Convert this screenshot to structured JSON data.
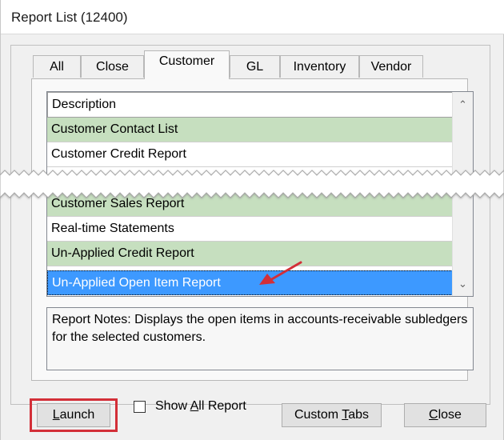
{
  "window": {
    "title": "Report List (12400)"
  },
  "tabs": [
    {
      "label": "All",
      "active": false
    },
    {
      "label": "Close",
      "active": false
    },
    {
      "label": "Customer",
      "active": true
    },
    {
      "label": "GL",
      "active": false
    },
    {
      "label": "Inventory",
      "active": false
    },
    {
      "label": "Vendor",
      "active": false
    }
  ],
  "report_list": {
    "header": "Description",
    "rows": [
      {
        "label": "Customer Contact List",
        "state": "green"
      },
      {
        "label": "Customer Credit Report",
        "state": "white"
      },
      {
        "label": "Customer Sales Report",
        "state": "green"
      },
      {
        "label": "Real-time Statements",
        "state": "white"
      },
      {
        "label": "Un-Applied Credit Report",
        "state": "green"
      },
      {
        "label": "Un-Applied Open Item Report",
        "state": "selected"
      }
    ]
  },
  "notes": {
    "text": "Report Notes:  Displays the open items in accounts-receivable subledgers for the selected customers."
  },
  "buttons": {
    "launch_prefix": "",
    "launch_underlined": "L",
    "launch_suffix": "aunch",
    "custom_prefix": "Custom ",
    "custom_underlined": "T",
    "custom_suffix": "abs",
    "close_prefix": "",
    "close_underlined": "C",
    "close_suffix": "lose"
  },
  "checkbox": {
    "label_prefix": "Show ",
    "label_underlined": "A",
    "label_suffix": "ll Report",
    "checked": false
  },
  "colors": {
    "row_green": "#c6dfbf",
    "row_selected": "#3d99ff",
    "annotation_red": "#d32f38"
  }
}
